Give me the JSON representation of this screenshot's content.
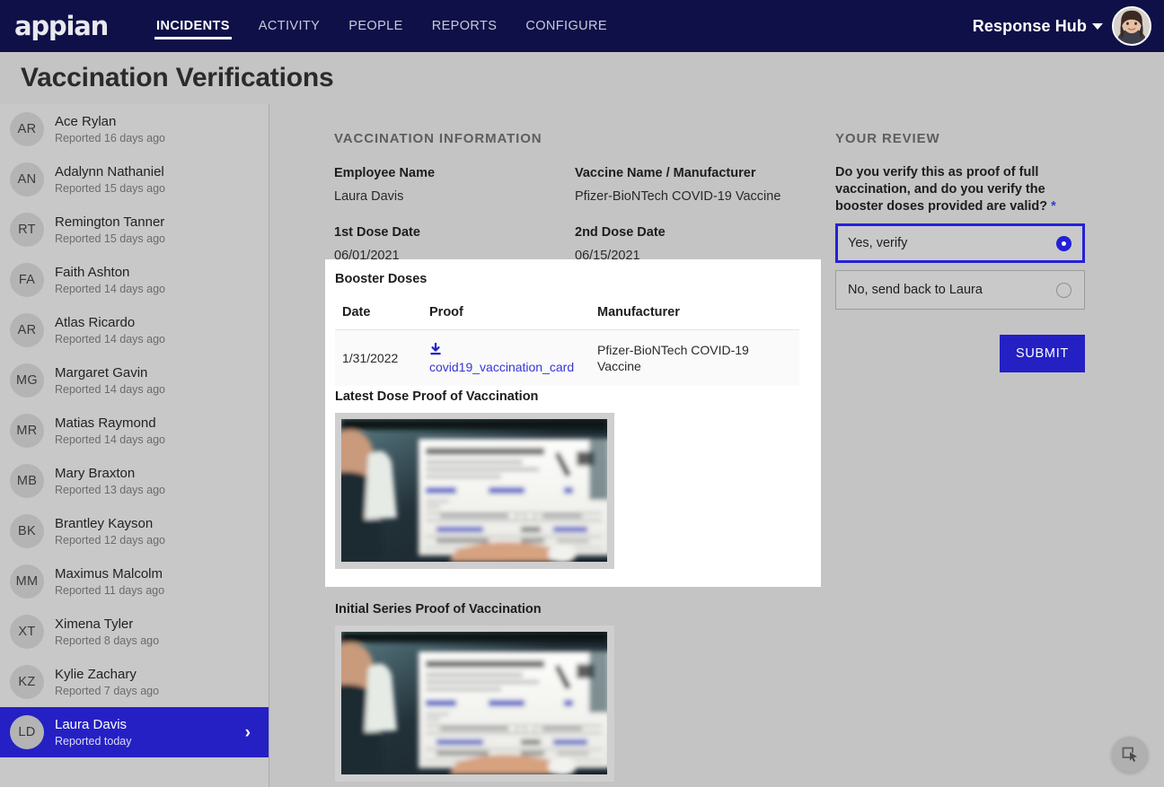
{
  "topnav": {
    "brand": "appian",
    "links": [
      {
        "label": "INCIDENTS",
        "active": true
      },
      {
        "label": "ACTIVITY",
        "active": false
      },
      {
        "label": "PEOPLE",
        "active": false
      },
      {
        "label": "REPORTS",
        "active": false
      },
      {
        "label": "CONFIGURE",
        "active": false
      }
    ],
    "hub_name": "Response Hub",
    "caret_icon": "chevron-down-icon",
    "avatar_icon": "user-avatar"
  },
  "page": {
    "title": "Vaccination Verifications"
  },
  "sidebar": {
    "items": [
      {
        "initials": "AR",
        "name": "Ace Rylan",
        "sub": "Reported 16 days ago",
        "selected": false
      },
      {
        "initials": "AN",
        "name": "Adalynn Nathaniel",
        "sub": "Reported 15 days ago",
        "selected": false
      },
      {
        "initials": "RT",
        "name": "Remington Tanner",
        "sub": "Reported 15 days ago",
        "selected": false
      },
      {
        "initials": "FA",
        "name": "Faith Ashton",
        "sub": "Reported 14 days ago",
        "selected": false
      },
      {
        "initials": "AR",
        "name": "Atlas Ricardo",
        "sub": "Reported 14 days ago",
        "selected": false
      },
      {
        "initials": "MG",
        "name": "Margaret Gavin",
        "sub": "Reported 14 days ago",
        "selected": false
      },
      {
        "initials": "MR",
        "name": "Matias Raymond",
        "sub": "Reported 14 days ago",
        "selected": false
      },
      {
        "initials": "MB",
        "name": "Mary Braxton",
        "sub": "Reported 13 days ago",
        "selected": false
      },
      {
        "initials": "BK",
        "name": "Brantley Kayson",
        "sub": "Reported 12 days ago",
        "selected": false
      },
      {
        "initials": "MM",
        "name": "Maximus Malcolm",
        "sub": "Reported 11 days ago",
        "selected": false
      },
      {
        "initials": "XT",
        "name": "Ximena Tyler",
        "sub": "Reported 8 days ago",
        "selected": false
      },
      {
        "initials": "KZ",
        "name": "Kylie Zachary",
        "sub": "Reported 7 days ago",
        "selected": false
      },
      {
        "initials": "LD",
        "name": "Laura Davis",
        "sub": "Reported today",
        "selected": true
      }
    ],
    "selected_chevron": "›"
  },
  "vaccination": {
    "section_title": "VACCINATION INFORMATION",
    "fields": [
      {
        "label": "Employee Name",
        "value": "Laura Davis"
      },
      {
        "label": "Vaccine Name / Manufacturer",
        "value": "Pfizer-BioNTech COVID-19 Vaccine"
      },
      {
        "label": "1st Dose Date",
        "value": "06/01/2021"
      },
      {
        "label": "2nd Dose Date",
        "value": "06/15/2021"
      }
    ]
  },
  "booster": {
    "title": "Booster Doses",
    "columns": [
      "Date",
      "Proof",
      "Manufacturer"
    ],
    "rows": [
      {
        "date": "1/31/2022",
        "proof_icon": "download-icon",
        "proof_link": "covid19_vaccination_card",
        "manufacturer": "Pfizer-BioNTech COVID-19 Vaccine"
      }
    ]
  },
  "proofs": {
    "latest": {
      "heading": "Latest Dose Proof of Vaccination",
      "image_alt": "photo of hands holding a COVID-19 vaccination record card"
    },
    "initial": {
      "heading": "Initial Series Proof of Vaccination",
      "image_alt": "photo of hands holding a COVID-19 vaccination record card"
    }
  },
  "review": {
    "section_title": "YOUR REVIEW",
    "question": "Do you verify this as proof of full vaccination, and do you verify the booster doses provided are valid?",
    "required_marker": "*",
    "options": [
      {
        "label": "Yes, verify",
        "selected": true
      },
      {
        "label": "No, send back to Laura",
        "selected": false
      }
    ],
    "submit_label": "SUBMIT"
  },
  "fab": {
    "icon": "screenshot-pointer-icon"
  },
  "colors": {
    "nav_bg": "#0f1048",
    "accent_blue": "#2420c4",
    "link_blue": "#3636d6",
    "page_bg": "#c4c4c4",
    "sidebar_bg": "#c8c8c8",
    "card_bg": "#ffffff"
  }
}
